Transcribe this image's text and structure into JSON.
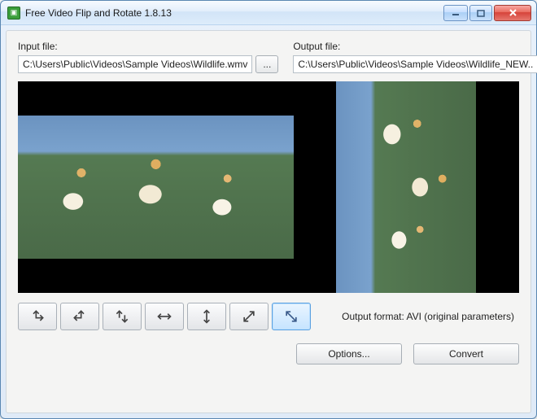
{
  "window": {
    "title": "Free Video Flip and Rotate 1.8.13"
  },
  "input": {
    "label": "Input file:",
    "path": "C:\\Users\\Public\\Videos\\Sample Videos\\Wildlife.wmv",
    "browse": "..."
  },
  "output": {
    "label": "Output file:",
    "path": "C:\\Users\\Public\\Videos\\Sample Videos\\Wildlife_NEW..",
    "browse": "..."
  },
  "operations": {
    "rotate_ccw": "rotate-ccw",
    "rotate_cw": "rotate-cw",
    "rotate_180": "rotate-180",
    "flip_horizontal": "flip-horizontal",
    "flip_vertical": "flip-vertical",
    "flip_diagonal_1": "flip-diagonal-up",
    "flip_diagonal_2": "flip-diagonal-down",
    "active": "flip-diagonal-down"
  },
  "status": {
    "output_format": "Output format: AVI (original parameters)"
  },
  "buttons": {
    "options": "Options...",
    "convert": "Convert"
  }
}
